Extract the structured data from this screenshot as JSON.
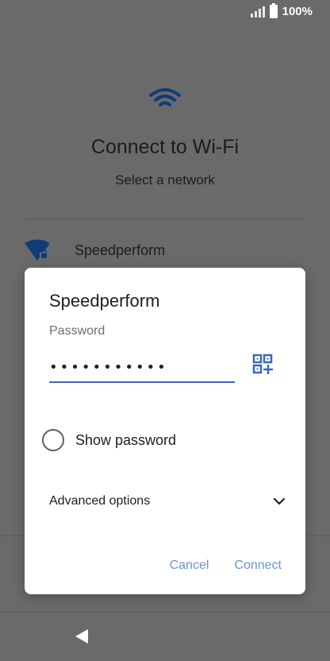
{
  "status_bar": {
    "battery_text": "100%",
    "icons": [
      "signal-icon",
      "battery-icon"
    ]
  },
  "background": {
    "title": "Connect to Wi-Fi",
    "subtitle": "Select a network",
    "network": {
      "name": "Speedperform",
      "icon": "wifi-locked-icon"
    }
  },
  "dialog": {
    "title": "Speedperform",
    "password_label": "Password",
    "password_value": "•••••••••••",
    "show_password_label": "Show password",
    "show_password_checked": false,
    "advanced_options_label": "Advanced options",
    "cancel_label": "Cancel",
    "connect_label": "Connect",
    "accent_color": "#3d68b8",
    "button_color": "#6d93d0"
  },
  "nav": {
    "back_icon": "back-icon"
  }
}
